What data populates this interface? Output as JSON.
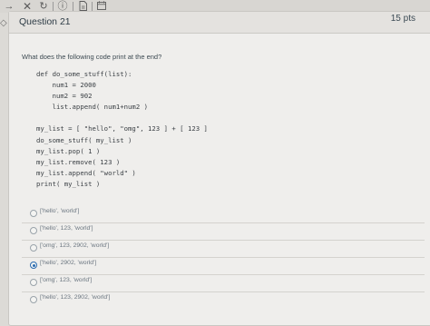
{
  "toolbar": {
    "icons": [
      "arrow-right-icon",
      "close-icon",
      "redo-icon",
      "info-icon",
      "document-icon",
      "calendar-icon"
    ],
    "info_glyph": "ⓘ"
  },
  "question": {
    "title": "Question 21",
    "points": "15 pts",
    "prompt": "What does the following code print at the end?"
  },
  "code_lines": [
    "def do_some_stuff(list):",
    "    num1 = 2000",
    "    num2 = 902",
    "    list.append( num1+num2 )",
    "",
    "my_list = [ \"hello\", \"omg\", 123 ] + [ 123 ]",
    "do_some_stuff( my_list )",
    "my_list.pop( 1 )",
    "my_list.remove( 123 )",
    "my_list.append( \"world\" )",
    "print( my_list )"
  ],
  "options": [
    {
      "label": "['hello', 'world']",
      "selected": false
    },
    {
      "label": "['hello', 123, 'world']",
      "selected": false
    },
    {
      "label": "['omg', 123, 2902, 'world']",
      "selected": false
    },
    {
      "label": "['hello', 2902, 'world']",
      "selected": true
    },
    {
      "label": "['omg', 123, 'world']",
      "selected": false
    },
    {
      "label": "['hello', 123, 2902, 'world']",
      "selected": false
    }
  ]
}
